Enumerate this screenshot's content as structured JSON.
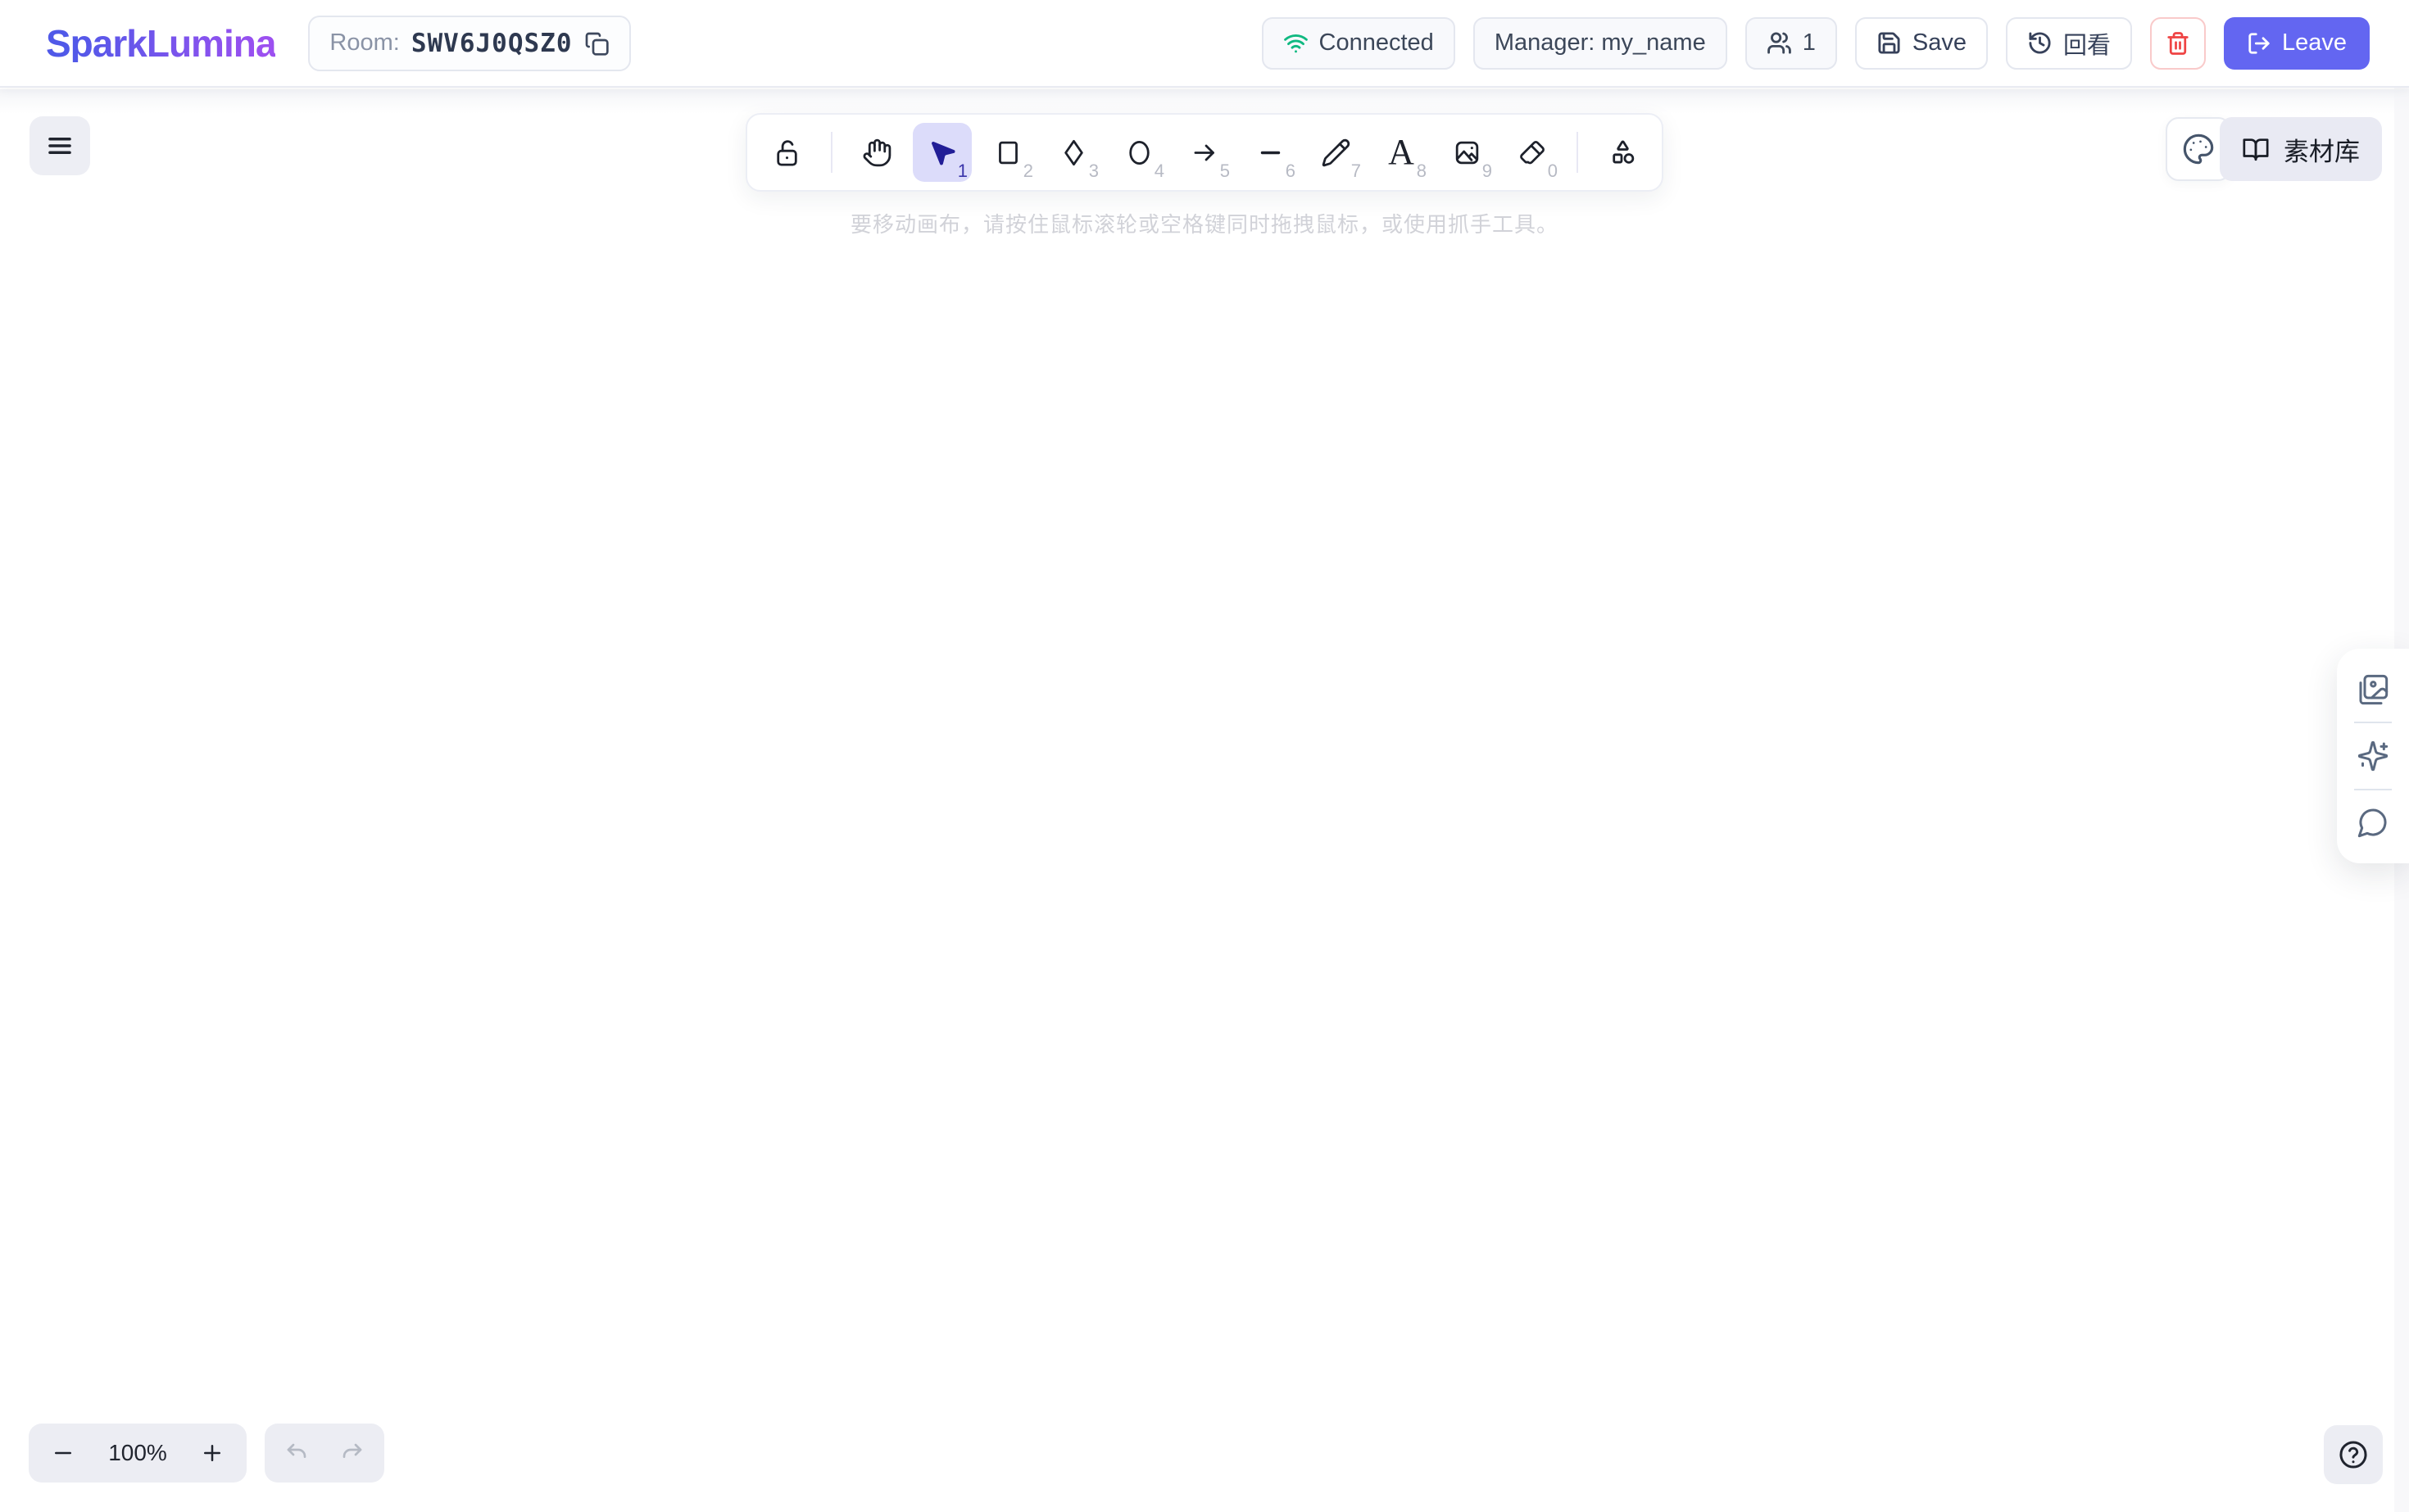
{
  "app": {
    "name": "SparkLumina"
  },
  "header": {
    "room": {
      "label": "Room:",
      "code": "SWV6J0QSZ0"
    },
    "connection": {
      "status": "Connected"
    },
    "manager": {
      "label": "Manager: my_name"
    },
    "participants": {
      "count": "1"
    },
    "save": {
      "label": "Save"
    },
    "replay": {
      "label": "回看"
    },
    "leave": {
      "label": "Leave"
    }
  },
  "toolbar": {
    "tools": [
      {
        "name": "lock",
        "shortcut": ""
      },
      {
        "name": "hand",
        "shortcut": ""
      },
      {
        "name": "select",
        "shortcut": "1",
        "active": true
      },
      {
        "name": "rectangle",
        "shortcut": "2"
      },
      {
        "name": "diamond",
        "shortcut": "3"
      },
      {
        "name": "ellipse",
        "shortcut": "4"
      },
      {
        "name": "arrow",
        "shortcut": "5"
      },
      {
        "name": "line",
        "shortcut": "6"
      },
      {
        "name": "draw",
        "shortcut": "7"
      },
      {
        "name": "text",
        "shortcut": "8",
        "glyph": "A"
      },
      {
        "name": "image",
        "shortcut": "9"
      },
      {
        "name": "eraser",
        "shortcut": "0"
      },
      {
        "name": "shapes",
        "shortcut": ""
      }
    ]
  },
  "canvas": {
    "hint": "要移动画布，请按住鼠标滚轮或空格键同时拖拽鼠标，或使用抓手工具。"
  },
  "side_right": {
    "library": {
      "label": "素材库"
    }
  },
  "footer": {
    "zoom": {
      "level": "100%"
    }
  },
  "colors": {
    "accent": "#6366f1",
    "connected_green": "#10b981",
    "danger_red": "#ef4444",
    "logo_gradient_start": "#5059e8",
    "logo_gradient_end": "#9c50f0",
    "active_tool_bg": "#dcdcfa",
    "active_tool_fg": "#221e97"
  }
}
